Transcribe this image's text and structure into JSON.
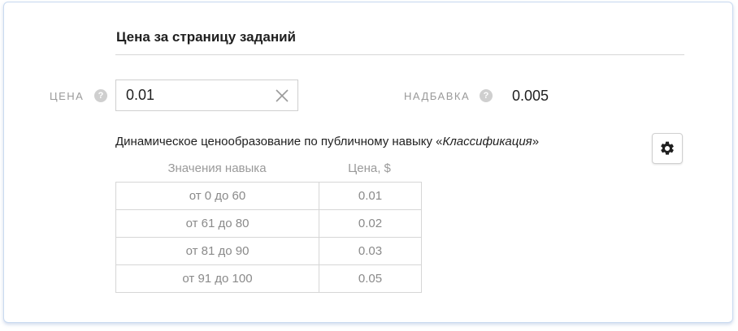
{
  "section": {
    "title": "Цена за страницу заданий"
  },
  "price": {
    "label": "ЦЕНА",
    "help": "?",
    "value": "0.01",
    "clear_icon": "close-icon"
  },
  "surcharge": {
    "label": "НАДБАВКА",
    "help": "?",
    "value": "0.005"
  },
  "dynamic_pricing": {
    "title_prefix": "Динамическое ценообразование по публичному навыку «",
    "skill_name": "Классификация",
    "title_suffix": "»",
    "settings_icon": "gear-icon",
    "columns": [
      "Значения навыка",
      "Цена, $"
    ],
    "rows": [
      {
        "range": "от 0 до 60",
        "price": "0.01"
      },
      {
        "range": "от 61 до 80",
        "price": "0.02"
      },
      {
        "range": "от 81 до 90",
        "price": "0.03"
      },
      {
        "range": "от 91 до 100",
        "price": "0.05"
      }
    ]
  },
  "colors": {
    "card_border": "#c9daf0",
    "label_gray": "#9a9a9a",
    "text_dark": "#1f1f1f"
  }
}
